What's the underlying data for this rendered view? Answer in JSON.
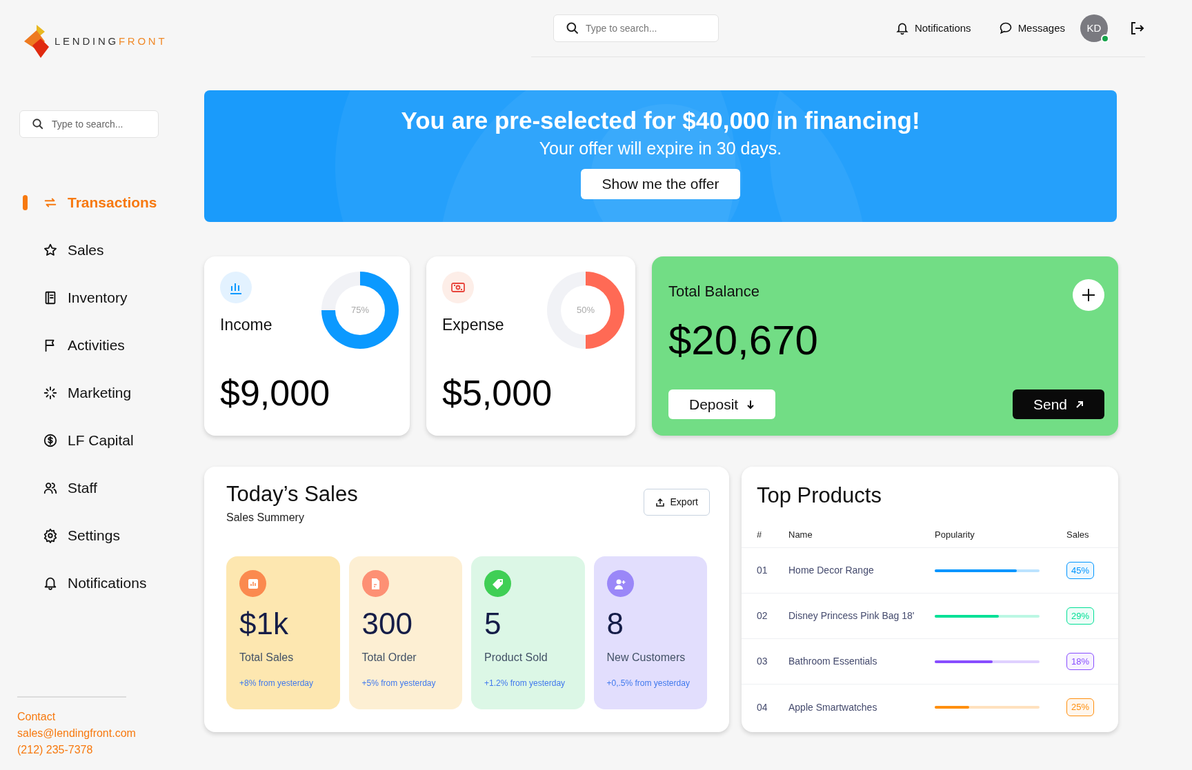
{
  "logo": {
    "part_1": "LENDING",
    "part_2": "FRONT"
  },
  "sidebar": {
    "search": {
      "placeholder": "Type to search..."
    },
    "items": [
      {
        "label": "Transactions",
        "selected": true
      },
      {
        "label": "Sales",
        "selected": false
      },
      {
        "label": "Inventory",
        "selected": false
      },
      {
        "label": "Activities",
        "selected": false
      },
      {
        "label": "Marketing",
        "selected": false
      },
      {
        "label": "LF Capital",
        "selected": false
      },
      {
        "label": "Staff",
        "selected": false
      },
      {
        "label": "Settings",
        "selected": false
      },
      {
        "label": "Notifications",
        "selected": false
      }
    ],
    "contact": {
      "label": "Contact",
      "email": "sales@lendingfront.com",
      "phone": "(212) 235-7378"
    }
  },
  "header": {
    "search": {
      "placeholder": "Type to search..."
    },
    "notifications": "Notifications",
    "messages": "Messages",
    "avatar": {
      "initials": "KD",
      "online": true
    }
  },
  "banner": {
    "title": "You are pre-selected for $40,000 in financing!",
    "subtitle": "Your offer will expire in 30 days.",
    "button": "Show me the offer"
  },
  "income": {
    "label": "Income",
    "amount": "$9,000",
    "chart_data": {
      "type": "donut",
      "values": [
        75,
        25
      ]
    },
    "reading": "75%"
  },
  "expense": {
    "label": "Expense",
    "amount": "$5,000",
    "chart_data": {
      "type": "donut",
      "values": [
        50,
        50
      ]
    },
    "reading": "50%"
  },
  "balance": {
    "title": "Total Balance",
    "amount": "$20,670",
    "deposit": "Deposit",
    "send": "Send"
  },
  "todays_sales": {
    "title": "Today’s Sales",
    "subtitle": "Sales Summery",
    "export": "Export",
    "stats": [
      {
        "value": "$1k",
        "label": "Total Sales",
        "change": "+8% from yesterday",
        "color": "#fb8a4f"
      },
      {
        "value": "300",
        "label": "Total Order",
        "change": "+5% from yesterday",
        "color": "#fd9074"
      },
      {
        "value": "5",
        "label": "Product Sold",
        "change": "+1.2% from yesterday",
        "color": "#3fcf55"
      },
      {
        "value": "8",
        "label": "New Customers",
        "change": "+0,.5% from yesterday",
        "color": "#9a87f8"
      }
    ]
  },
  "top_products": {
    "title": "Top Products",
    "columns": [
      "#",
      "Name",
      "Popularity",
      "Sales"
    ],
    "rows": [
      {
        "number": "01",
        "name": "Home Decor Range",
        "level": 0.78,
        "sales": "45%",
        "color": "#0095ff"
      },
      {
        "number": "02",
        "name": "Disney Princess Pink Bag 18'",
        "level": 0.61,
        "sales": "29%",
        "color": "#00e096"
      },
      {
        "number": "03",
        "name": "Bathroom Essentials",
        "level": 0.55,
        "sales": "18%",
        "color": "#884dff"
      },
      {
        "number": "04",
        "name": "Apple Smartwatches",
        "level": 0.33,
        "sales": "25%",
        "color": "#ff8f0d"
      }
    ]
  }
}
